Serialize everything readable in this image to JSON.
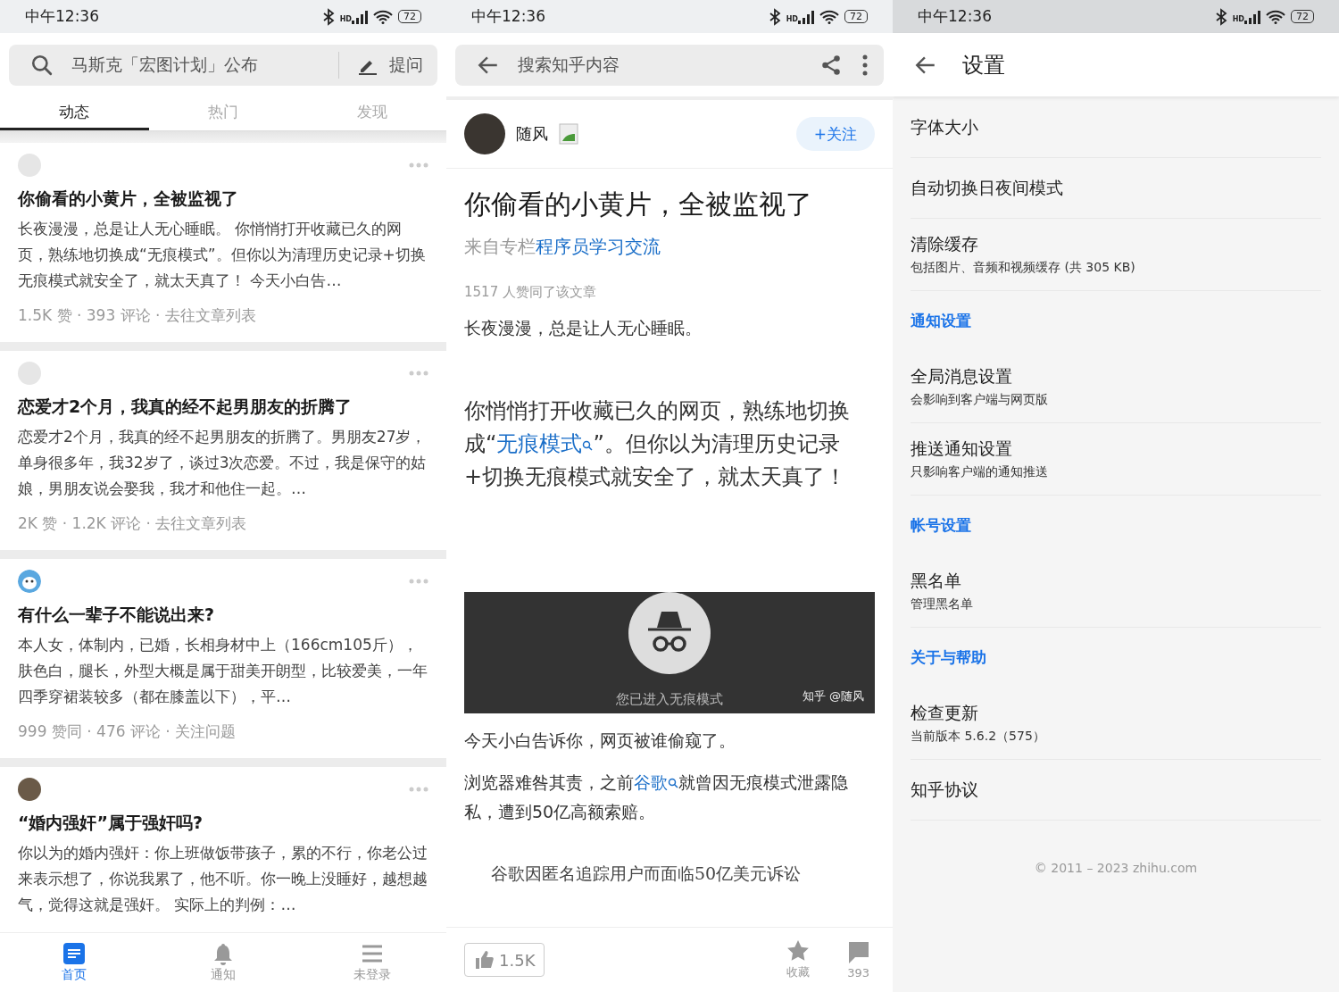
{
  "feed_screen": {
    "status_bar": {
      "time": "中午12:36",
      "network": "HD",
      "battery": "72"
    },
    "search": {
      "placeholder": "马斯克「宏图计划」公布",
      "ask_button": "提问"
    },
    "tabs": [
      {
        "label": "动态",
        "selected": true
      },
      {
        "label": "热门",
        "selected": false
      },
      {
        "label": "发现",
        "selected": false
      }
    ],
    "cards": [
      {
        "kind": "empty_avatar",
        "title": "你偷看的小黄片，全被监视了",
        "excerpt": "长夜漫漫，总是让人无心睡眠。 你悄悄打开收藏已久的网页，熟练地切换成“无痕模式”。但你以为清理历史记录+切换无痕模式就安全了，就太天真了！ 今天小白告…",
        "meta": "1.5K 赞 · 393 评论 · 去往文章列表"
      },
      {
        "kind": "empty_avatar",
        "title": "恋爱才2个月，我真的经不起男朋友的折腾了",
        "excerpt": "恋爱才2个月，我真的经不起男朋友的折腾了。男朋友27岁，单身很多年，我32岁了，谈过3次恋爱。不过，我是保守的姑娘，男朋友说会娶我，我才和他住一起。…",
        "meta": "2K 赞 · 1.2K 评论 · 去往文章列表"
      },
      {
        "kind": "cartoon_avatar",
        "title": "有什么一辈子不能说出来?",
        "excerpt": "本人女，体制内，已婚，长相身材中上（166cm105斤），肤色白，腿长，外型大概是属于甜美开朗型，比较爱美，一年四季穿裙装较多（都在膝盖以下），平…",
        "meta": "999 赞同 · 476 评论 · 关注问题"
      },
      {
        "kind": "photo_avatar",
        "title": "“婚内强奸”属于强奸吗?",
        "excerpt": "你以为的婚内强奸：你上班做饭带孩子，累的不行，你老公过来表示想了，你说我累了，他不听。你一晚上没睡好，越想越气，觉得这就是强奸。 实际上的判例：…"
      }
    ],
    "bottom_nav": [
      {
        "kind": "home",
        "label": "首页",
        "selected": true
      },
      {
        "kind": "bell",
        "label": "通知",
        "selected": false
      },
      {
        "kind": "menu",
        "label": "未登录",
        "selected": false
      }
    ]
  },
  "article_screen": {
    "status_bar": {
      "time": "中午12:36",
      "network": "HD",
      "battery": "72"
    },
    "search": {
      "placeholder": "搜索知乎内容"
    },
    "author": {
      "name": "随风",
      "follow_button": "+关注"
    },
    "title": "你偷看的小黄片，全被监视了",
    "column": {
      "prefix": "来自专栏",
      "link": "程序员学习交流"
    },
    "likes_line": "1517 人赞同了该文章",
    "blocks": [
      {
        "kind": "text",
        "parts": [
          {
            "text": "长夜漫漫，总是让人无心睡眠。",
            "link": false
          }
        ]
      },
      {
        "kind": "lead",
        "parts": [
          {
            "text": "你悄悄打开收藏已久的网页，熟练地切换成“",
            "link": false
          },
          {
            "text": "无痕模式",
            "link": true
          },
          {
            "text": "”。但你以为清理历史记录+切换无痕模式就安全了，就太天真了！",
            "link": false
          }
        ]
      },
      {
        "kind": "image",
        "caption": "您已进入无痕模式",
        "credit": "知乎 @随风"
      },
      {
        "kind": "text",
        "parts": [
          {
            "text": "今天小白告诉你，网页被谁偷窥了。",
            "link": false
          }
        ]
      },
      {
        "kind": "text",
        "parts": [
          {
            "text": "浏览器难咎其责，之前",
            "link": false
          },
          {
            "text": "谷歌",
            "link": true
          },
          {
            "text": "就曾因无痕模式泄露隐私，遭到50亿高额索赔。",
            "link": false
          }
        ]
      },
      {
        "kind": "link_card",
        "title": "谷歌因匿名追踪用户而面临50亿美元诉讼"
      }
    ],
    "bottom_bar": {
      "like_count": "1.5K",
      "favorite": "收藏",
      "comments": "393"
    }
  },
  "settings_screen": {
    "status_bar": {
      "time": "中午12:36",
      "network": "HD",
      "battery": "72"
    },
    "title": "设置",
    "items": [
      {
        "kind": "item",
        "label": "字体大小"
      },
      {
        "kind": "item",
        "label": "自动切换日夜间模式"
      },
      {
        "kind": "item",
        "label": "清除缓存",
        "sub": "包括图片、音频和视频缓存 (共 305 KB)"
      },
      {
        "kind": "section",
        "label": "通知设置"
      },
      {
        "kind": "item",
        "label": "全局消息设置",
        "sub": "会影响到客户端与网页版"
      },
      {
        "kind": "item",
        "label": "推送通知设置",
        "sub": "只影响客户端的通知推送"
      },
      {
        "kind": "section",
        "label": "帐号设置"
      },
      {
        "kind": "item",
        "label": "黑名单",
        "sub": "管理黑名单"
      },
      {
        "kind": "section",
        "label": "关于与帮助"
      },
      {
        "kind": "item",
        "label": "检查更新",
        "sub": "当前版本 5.6.2（575）"
      },
      {
        "kind": "item",
        "label": "知乎协议"
      }
    ],
    "footer": "© 2011 – 2023 zhihu.com"
  }
}
